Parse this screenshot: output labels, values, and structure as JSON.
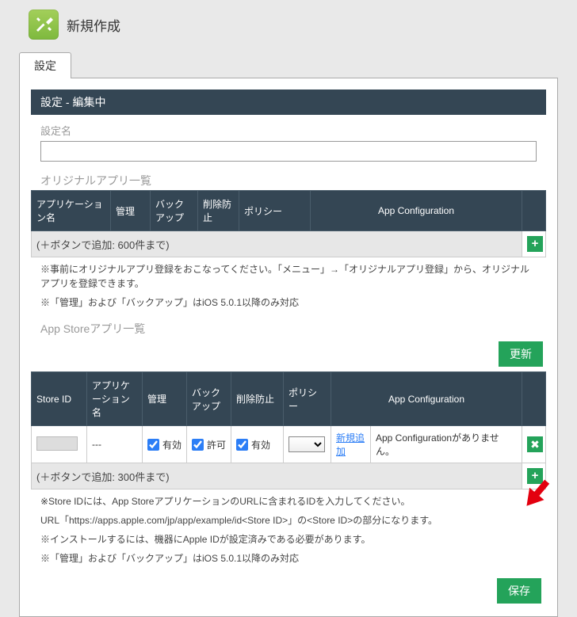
{
  "header": {
    "title": "新規作成"
  },
  "tabs": {
    "main": "設定"
  },
  "section_title": "設定 - 編集中",
  "form": {
    "name_label": "設定名",
    "name_value": ""
  },
  "orig": {
    "list_title": "オリジナルアプリ一覧",
    "cols": {
      "app_name": "アプリケーション名",
      "manage": "管理",
      "backup": "バックアップ",
      "delete_protect": "削除防止",
      "policy": "ポリシー",
      "app_config": "App Configuration"
    },
    "add_hint": "(＋ボタンで追加: 600件まで)",
    "notes": [
      "※事前にオリジナルアプリ登録をおこなってください。「メニュー」→「オリジナルアプリ登録」から、オリジナルアプリを登録できます。",
      "※「管理」および「バックアップ」はiOS 5.0.1以降のみ対応"
    ]
  },
  "store": {
    "list_title": "App Storeアプリ一覧",
    "update_btn": "更新",
    "cols": {
      "store_id": "Store ID",
      "app_name": "アプリケーション名",
      "manage": "管理",
      "backup": "バックアップ",
      "delete_protect": "削除防止",
      "policy": "ポリシー",
      "app_config": "App Configuration"
    },
    "row": {
      "app_name": "---",
      "manage_checked": true,
      "manage_label": "有効",
      "backup_checked": true,
      "backup_label": "許可",
      "delete_checked": true,
      "delete_label": "有効",
      "policy_value": "",
      "link_add": "新規追加",
      "app_config_text": "App Configurationがありません。"
    },
    "add_hint": "(＋ボタンで追加: 300件まで)",
    "notes": [
      "※Store IDには、App StoreアプリケーションのURLに含まれるIDを入力してください。",
      "URL「https://apps.apple.com/jp/app/example/id<Store ID>」の<Store ID>の部分になります。",
      "※インストールするには、機器にApple IDが設定済みである必要があります。",
      "※「管理」および「バックアップ」はiOS 5.0.1以降のみ対応"
    ]
  },
  "save_btn": "保存"
}
